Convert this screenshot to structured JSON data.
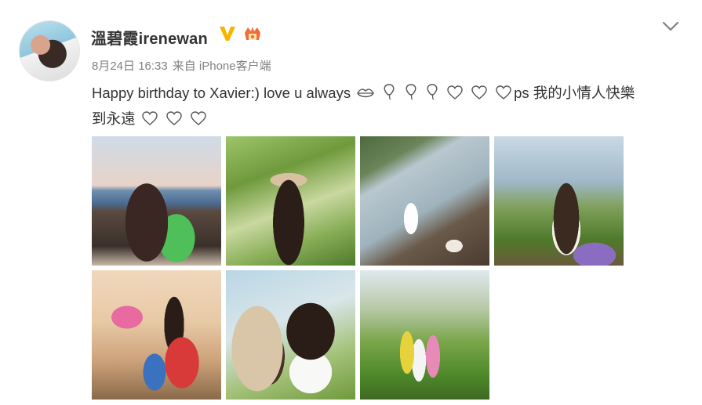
{
  "post": {
    "username": "溫碧霞irenewan",
    "meta": {
      "date_time": "8月24日 16:33",
      "source": "来自 iPhone客户端"
    },
    "text_line1_part1": "Happy birthday to Xavier:) love u always",
    "text_line1_part2": "ps 我的小情人快樂",
    "text_line2": "到永遠",
    "icons": {
      "verified": "verified-v-icon",
      "vip": "vip-crown-icon",
      "options": "chevron-down-icon",
      "lips": "lips-emoji-icon",
      "balloon": "balloon-emoji-icon",
      "heart": "heart-outline-emoji-icon"
    },
    "photos_count": 7
  },
  "colors": {
    "text_primary": "#333333",
    "text_meta": "#808080",
    "verified_gold": "#f7b500",
    "vip_orange": "#f26b3a"
  }
}
